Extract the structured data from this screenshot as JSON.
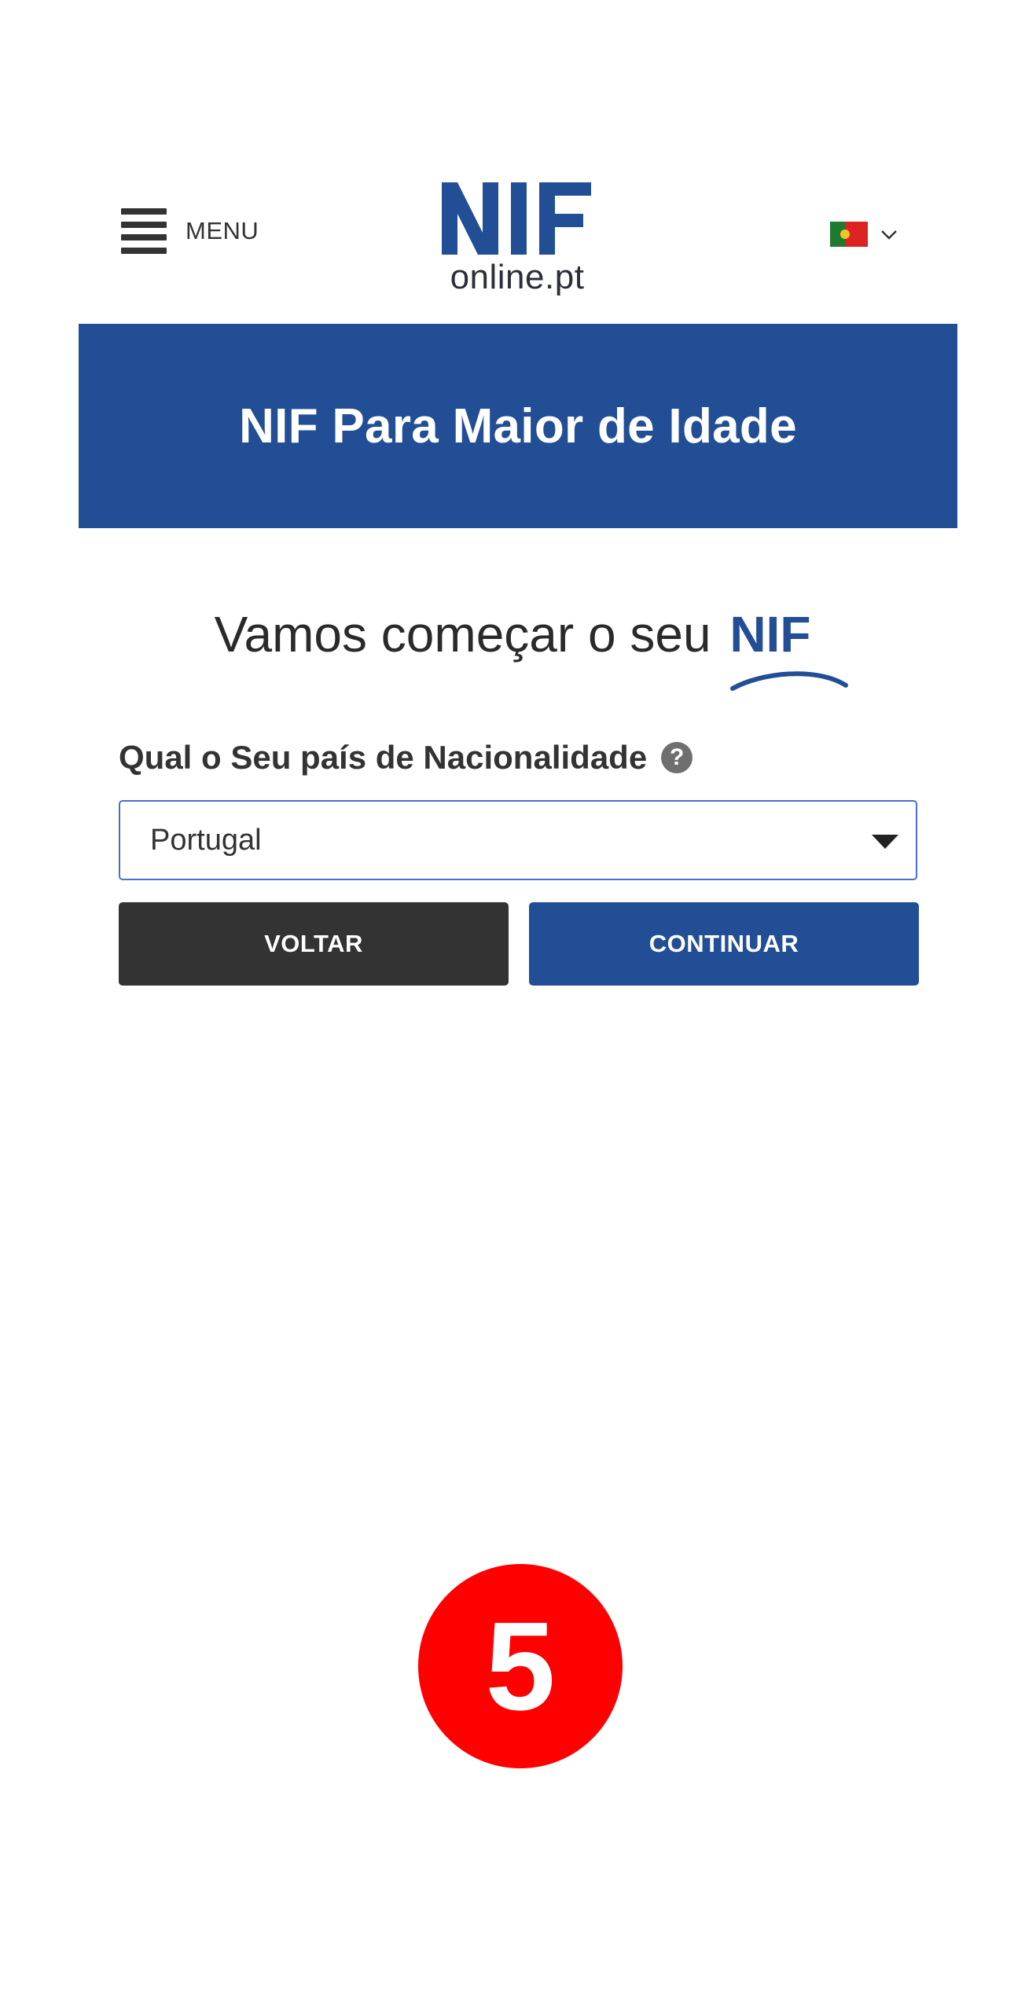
{
  "header": {
    "menu_label": "MENU",
    "logo": {
      "main_text": "NIF",
      "sub_text": "online.pt"
    },
    "language": {
      "flag_icon": "flag-portugal-icon",
      "chevron_icon": "chevron-down-icon"
    }
  },
  "banner": {
    "title": "NIF Para Maior de Idade"
  },
  "heading": {
    "text": "Vamos começar o seu",
    "brand_word": "NIF"
  },
  "form": {
    "nationality_label": "Qual o Seu país de Nacionalidade",
    "help_icon_glyph": "?",
    "country_select": {
      "selected_value": "Portugal"
    },
    "back_button": "VOLTAR",
    "continue_button": "CONTINUAR"
  },
  "step_badge": {
    "number": "5"
  },
  "colors": {
    "brand_blue": "#224e95",
    "dark_button": "#333333",
    "select_border": "#4a6fd0",
    "badge_red": "#ff0000"
  }
}
